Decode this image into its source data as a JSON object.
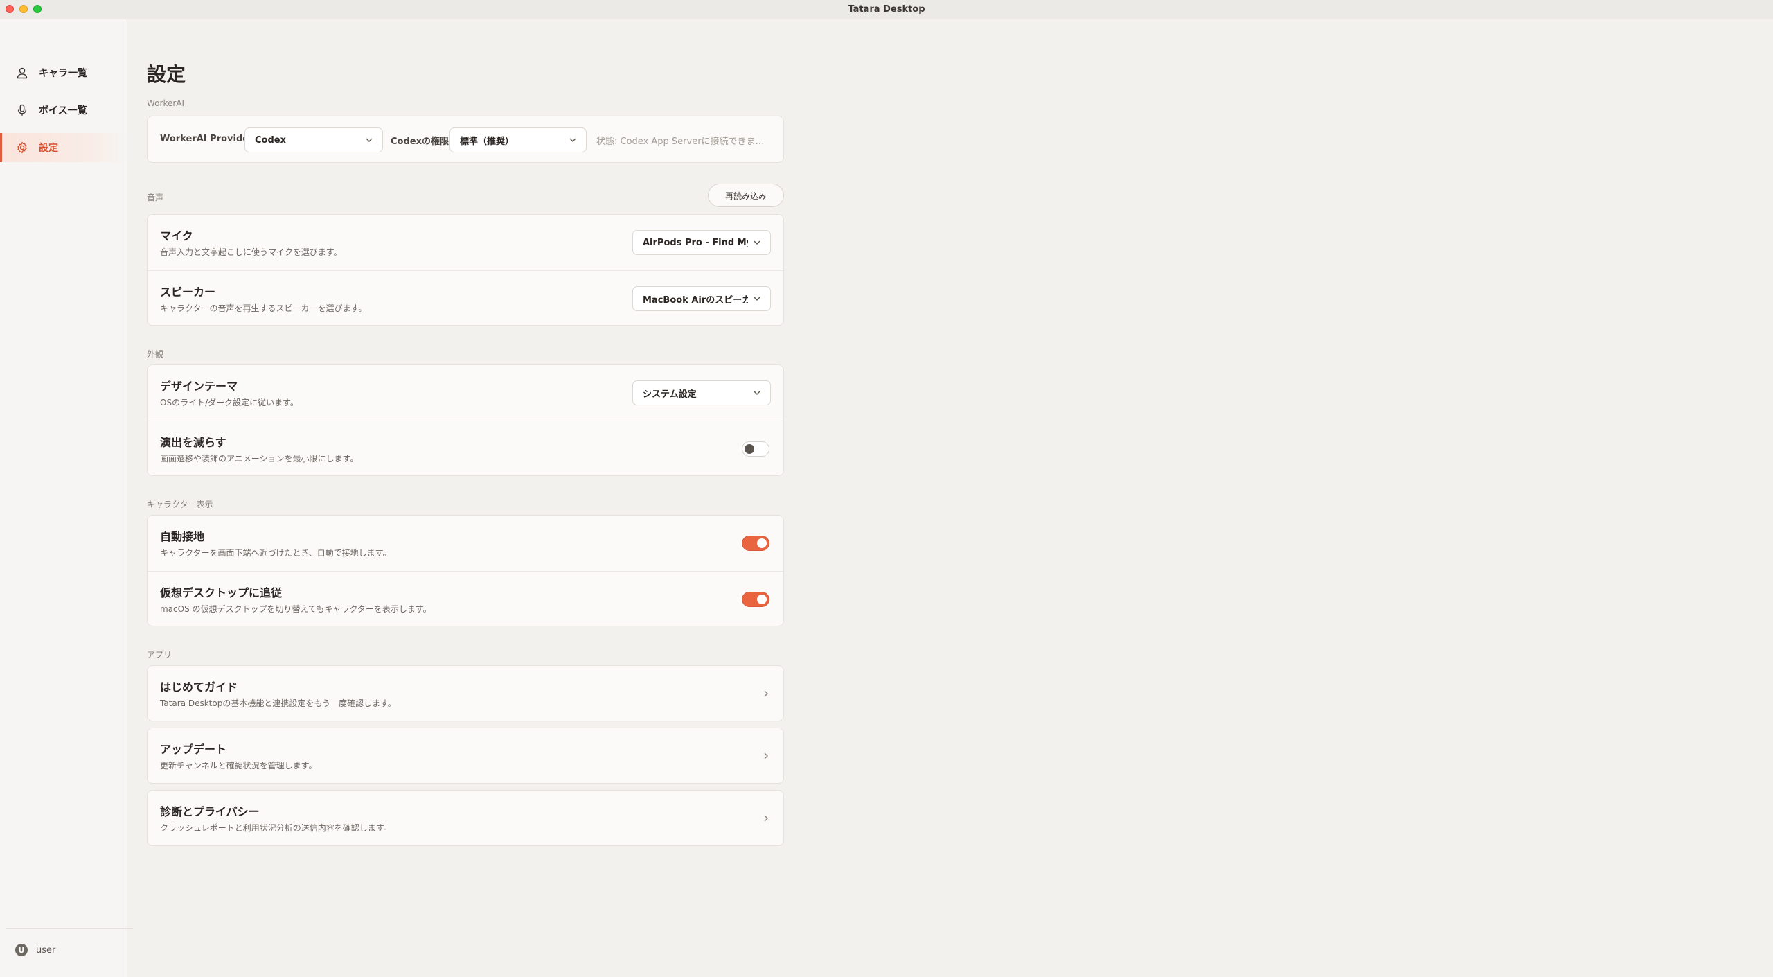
{
  "window": {
    "title": "Tatara Desktop"
  },
  "sidebar": {
    "items": [
      {
        "label": "キャラ一覧",
        "icon": "person-icon"
      },
      {
        "label": "ボイス一覧",
        "icon": "microphone-icon"
      },
      {
        "label": "設定",
        "icon": "gear-icon",
        "active": true
      }
    ],
    "user": {
      "avatar_letter": "U",
      "name": "user"
    }
  },
  "page": {
    "title": "設定"
  },
  "workerai": {
    "section_label": "WorkerAI",
    "provider_label": "WorkerAI Provider",
    "provider_value": "Codex",
    "permission_label": "Codexの権限",
    "permission_value": "標準（推奨）",
    "status_text": "状態: Codex App Serverに接続できま…"
  },
  "audio": {
    "section_label": "音声",
    "reload_label": "再読み込み",
    "mic": {
      "title": "マイク",
      "desc": "音声入力と文字起こしに使うマイクを選びます。",
      "value": "AirPods Pro - Find My"
    },
    "speaker": {
      "title": "スピーカー",
      "desc": "キャラクターの音声を再生するスピーカーを選びます。",
      "value": "MacBook Airのスピーカ…"
    }
  },
  "appearance": {
    "section_label": "外観",
    "theme": {
      "title": "デザインテーマ",
      "desc": "OSのライト/ダーク設定に従います。",
      "value": "システム設定"
    },
    "reduce_motion": {
      "title": "演出を減らす",
      "desc": "画面遷移や装飾のアニメーションを最小限にします。",
      "enabled": false
    }
  },
  "character_display": {
    "section_label": "キャラクター表示",
    "auto_ground": {
      "title": "自動接地",
      "desc": "キャラクターを画面下端へ近づけたとき、自動で接地します。",
      "enabled": true
    },
    "follow_desktop": {
      "title": "仮想デスクトップに追従",
      "desc": "macOS の仮想デスクトップを切り替えてもキャラクターを表示します。",
      "enabled": true
    }
  },
  "app": {
    "section_label": "アプリ",
    "items": [
      {
        "title": "はじめてガイド",
        "desc": "Tatara Desktopの基本機能と連携設定をもう一度確認します。"
      },
      {
        "title": "アップデート",
        "desc": "更新チャンネルと確認状況を管理します。"
      },
      {
        "title": "診断とプライバシー",
        "desc": "クラッシュレポートと利用状況分析の送信内容を確認します。"
      }
    ]
  },
  "colors": {
    "accent": "#e8653f",
    "background": "#f3f1ee",
    "card": "#fbfaf8"
  }
}
